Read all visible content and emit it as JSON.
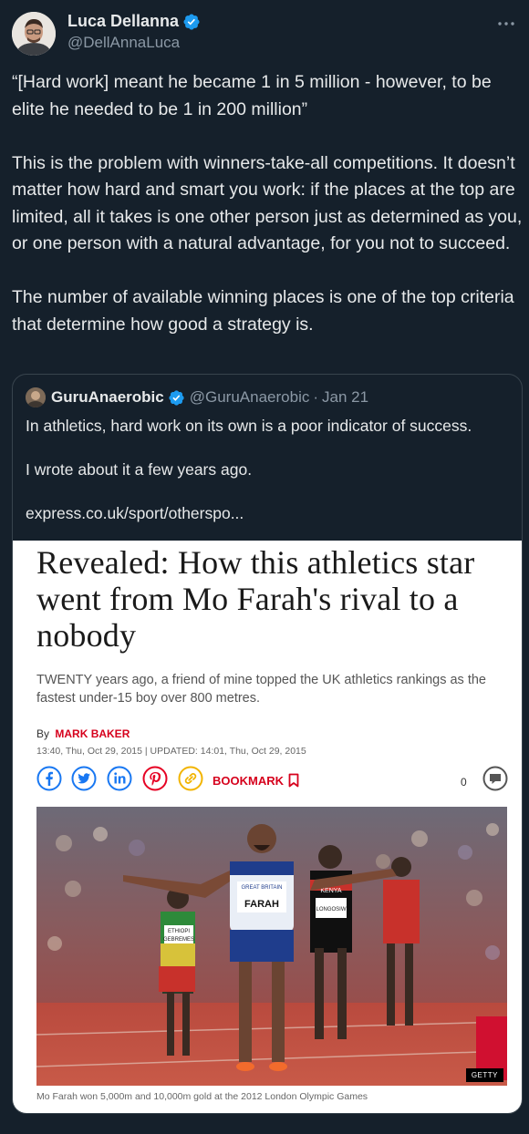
{
  "author": {
    "display_name": "Luca Dellanna",
    "handle": "@DellAnnaLuca",
    "verified_icon": "verified-badge-icon",
    "more_icon": "more-horizontal-icon"
  },
  "tweet": {
    "paragraphs": [
      "“[Hard work] meant he became 1 in 5 million - however, to be elite he needed to be 1 in 200 million”",
      "This is the problem with winners-take-all competitions. It doesn’t matter how hard and smart you work: if the places at the top are limited, all it takes is one other person just as determined as you, or one person with a natural advantage, for you not to succeed.",
      "The number of available winning places is one of the top criteria that determine how good a strategy is."
    ]
  },
  "quoted": {
    "display_name": "GuruAnaerobic",
    "handle": "@GuruAnaerobic",
    "separator": "·",
    "date": "Jan 21",
    "paragraphs": [
      "In athletics, hard work on its own is a poor indicator of success.",
      "I wrote about it a few years ago.",
      "express.co.uk/sport/otherspo..."
    ],
    "article": {
      "headline": "Revealed: How this athletics star went from Mo Farah's rival to a nobody",
      "standfirst": "TWENTY years ago, a friend of mine topped the UK athletics rankings as the fastest under-15 boy over 800 metres.",
      "byline_prefix": "By",
      "author": "MARK BAKER",
      "dateline": "13:40, Thu, Oct 29, 2015 | UPDATED: 14:01, Thu, Oct 29, 2015",
      "share_icons": [
        "facebook-icon",
        "twitter-icon",
        "linkedin-icon",
        "pinterest-icon",
        "link-icon"
      ],
      "bookmark_label": "BOOKMARK",
      "comment_count": "0",
      "photo_credit": "GETTY",
      "bib_farah_top": "GREAT BRITAIN",
      "bib_farah_name": "FARAH",
      "bib_left_top": "ETHIOPI",
      "bib_left_name": "GEBREMES",
      "bib_right_top": "KENYA",
      "bib_right_name": "LONGOSIW",
      "caption": "Mo Farah won 5,000m and 10,000m gold at the 2012 London Olympic Games",
      "colors": {
        "brand_red": "#d6001c",
        "share_blue": "#1877f2",
        "pinterest_red": "#e60023",
        "link_yellow": "#f2b400"
      }
    }
  },
  "colors": {
    "background": "#15202b",
    "text": "#e7e9ea",
    "secondary": "#8b98a5",
    "verified": "#1d9bf0",
    "border": "#38444d"
  }
}
